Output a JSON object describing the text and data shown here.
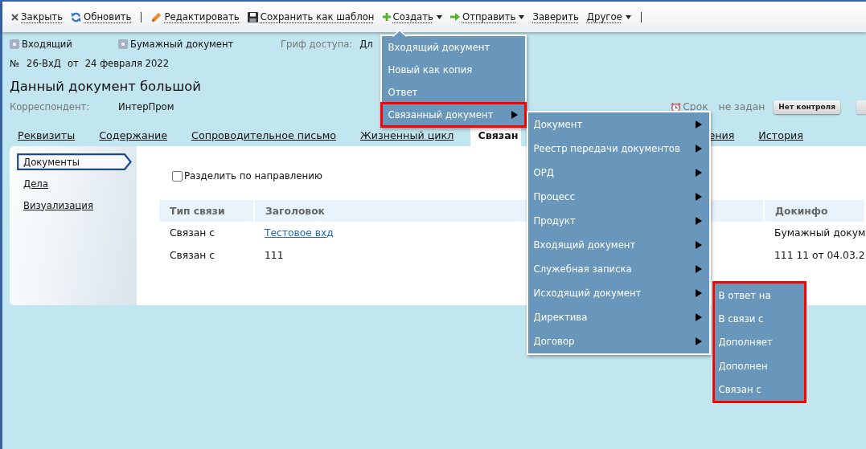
{
  "toolbar": {
    "items": [
      {
        "kind": "button",
        "label": "Закрыть",
        "dropdown": false
      },
      {
        "kind": "button",
        "label": "Обновить",
        "dropdown": false
      },
      {
        "kind": "separator"
      },
      {
        "kind": "button",
        "label": "Редактировать",
        "dropdown": false
      },
      {
        "kind": "button",
        "label": "Сохранить как шаблон",
        "dropdown": false
      },
      {
        "kind": "button",
        "label": "Создать",
        "dropdown": true,
        "menu": {
          "items": [
            {
              "label": "Входящий документ",
              "has_submenu": false,
              "highlighted": false
            },
            {
              "label": "Новый как копия",
              "has_submenu": false,
              "highlighted": false
            },
            {
              "label": "Ответ",
              "has_submenu": false,
              "highlighted": false
            },
            {
              "label": "Связанный документ",
              "has_submenu": true,
              "highlighted": true,
              "menu": {
                "items": [
                  {
                    "label": "Документ",
                    "has_submenu": true,
                    "highlighted": false
                  },
                  {
                    "label": "Реестр передачи документов",
                    "has_submenu": true,
                    "highlighted": false
                  },
                  {
                    "label": "ОРД",
                    "has_submenu": true,
                    "highlighted": false
                  },
                  {
                    "label": "Процесс",
                    "has_submenu": true,
                    "highlighted": false
                  },
                  {
                    "label": "Продукт",
                    "has_submenu": true,
                    "highlighted": false
                  },
                  {
                    "label": "Входящий документ",
                    "has_submenu": true,
                    "highlighted": false
                  },
                  {
                    "label": "Служебная записка",
                    "has_submenu": true,
                    "highlighted": false
                  },
                  {
                    "label": "Исходящий документ",
                    "has_submenu": true,
                    "highlighted": false,
                    "menu": {
                      "highlighted": true,
                      "items": [
                        {
                          "label": "В ответ на"
                        },
                        {
                          "label": "В связи с"
                        },
                        {
                          "label": "Дополняет"
                        },
                        {
                          "label": "Дополнен"
                        },
                        {
                          "label": "Связан с"
                        }
                      ]
                    }
                  },
                  {
                    "label": "Директива",
                    "has_submenu": true,
                    "highlighted": false
                  },
                  {
                    "label": "Договор",
                    "has_submenu": true,
                    "highlighted": false
                  }
                ]
              }
            }
          ]
        }
      },
      {
        "kind": "button",
        "label": "Отправить",
        "dropdown": true
      },
      {
        "kind": "button",
        "label": "Заверить",
        "dropdown": false
      },
      {
        "kind": "button",
        "label": "Другое",
        "dropdown": true
      },
      {
        "kind": "separator"
      }
    ]
  },
  "doc": {
    "badges": [
      {
        "label": "Входящий"
      },
      {
        "label": "Бумажный документ"
      }
    ],
    "access": {
      "label": "Гриф доступа:",
      "value": "Дл"
    },
    "number": {
      "label": "№",
      "value": "26-ВхД",
      "date_label": "от",
      "date": "24 февраля 2022"
    },
    "title": "Данный документ большой",
    "correspondent": {
      "label": "Корреспондент:",
      "value": "ИнтерПром"
    },
    "deadline": {
      "label": "Срок",
      "value": "не задан"
    },
    "control_button": "Нет контроля"
  },
  "tabs": [
    {
      "label": "Реквизиты",
      "selected": false
    },
    {
      "label": "Содержание",
      "selected": false
    },
    {
      "label": "Сопроводительное письмо",
      "selected": false
    },
    {
      "label": "Жизненный цикл",
      "selected": false
    },
    {
      "label": "Связан",
      "selected": true
    },
    {
      "label": "ения",
      "selected": false
    },
    {
      "label": "История",
      "selected": false
    }
  ],
  "sidebar": {
    "items": [
      {
        "label": "Документы",
        "selected": true
      },
      {
        "label": "Дела",
        "selected": false
      },
      {
        "label": "Визуализация",
        "selected": false
      }
    ]
  },
  "split_checkbox": {
    "label": "Разделить по направлению",
    "checked": false
  },
  "table": {
    "columns": [
      "Тип связи",
      "Заголовок",
      "Докинфо"
    ],
    "rows": [
      [
        {
          "text": "Связан с",
          "link": false
        },
        {
          "text": "Тестовое вхд",
          "link": true
        },
        {
          "text": "Бумажный докум",
          "link": false
        }
      ],
      [
        {
          "text": "Связан с",
          "link": false
        },
        {
          "text": "111",
          "link": false
        },
        {
          "text": "111 11 от 04.03.2",
          "link": false
        }
      ]
    ]
  }
}
